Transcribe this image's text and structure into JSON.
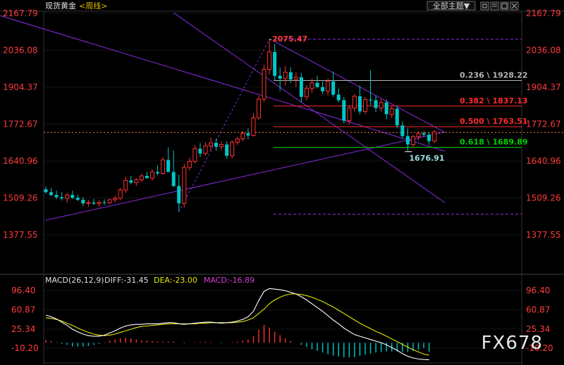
{
  "header": {
    "instrument": "现货黄金",
    "period": "<周线>",
    "menu_button": "全部主题▼",
    "window_controls": [
      "restore-icon",
      "window-icon",
      "window-expand-icon",
      "close-icon"
    ]
  },
  "colors": {
    "background": "#000000",
    "price_labels": "#ff3b3b",
    "up_candle": "#ff3232",
    "down_candle": "#00c8c8",
    "channel_lines": "#8a2be2",
    "fib_0236": "#b4b4b4",
    "fib_0382": "#ff2a2a",
    "fib_0500": "#ff2a2a",
    "fib_0618": "#00d000",
    "diff_line": "#ffffff",
    "dea_line": "#e6e600",
    "macd_label": "#d040d0"
  },
  "chart_data": [
    {
      "type": "candlestick",
      "title": "现货黄金<周线>",
      "ylim": [
        1377.55,
        2167.79
      ],
      "y_ticks": [
        "2167.79",
        "2036.08",
        "1904.37",
        "1772.67",
        "1640.96",
        "1509.26",
        "1377.55"
      ],
      "candles": [
        {
          "o": 1540,
          "h": 1550,
          "l": 1525,
          "c": 1530
        },
        {
          "o": 1530,
          "h": 1545,
          "l": 1515,
          "c": 1520
        },
        {
          "o": 1520,
          "h": 1535,
          "l": 1505,
          "c": 1512
        },
        {
          "o": 1512,
          "h": 1530,
          "l": 1500,
          "c": 1508
        },
        {
          "o": 1508,
          "h": 1528,
          "l": 1492,
          "c": 1520
        },
        {
          "o": 1520,
          "h": 1535,
          "l": 1505,
          "c": 1510
        },
        {
          "o": 1510,
          "h": 1522,
          "l": 1498,
          "c": 1503
        },
        {
          "o": 1503,
          "h": 1512,
          "l": 1480,
          "c": 1490
        },
        {
          "o": 1490,
          "h": 1502,
          "l": 1478,
          "c": 1493
        },
        {
          "o": 1493,
          "h": 1506,
          "l": 1484,
          "c": 1489
        },
        {
          "o": 1489,
          "h": 1500,
          "l": 1478,
          "c": 1494
        },
        {
          "o": 1494,
          "h": 1504,
          "l": 1484,
          "c": 1492
        },
        {
          "o": 1492,
          "h": 1506,
          "l": 1488,
          "c": 1503
        },
        {
          "o": 1503,
          "h": 1518,
          "l": 1493,
          "c": 1508
        },
        {
          "o": 1508,
          "h": 1545,
          "l": 1502,
          "c": 1538
        },
        {
          "o": 1538,
          "h": 1585,
          "l": 1528,
          "c": 1572
        },
        {
          "o": 1572,
          "h": 1588,
          "l": 1558,
          "c": 1564
        },
        {
          "o": 1564,
          "h": 1580,
          "l": 1552,
          "c": 1574
        },
        {
          "o": 1574,
          "h": 1595,
          "l": 1566,
          "c": 1588
        },
        {
          "o": 1588,
          "h": 1603,
          "l": 1578,
          "c": 1580
        },
        {
          "o": 1580,
          "h": 1612,
          "l": 1572,
          "c": 1602
        },
        {
          "o": 1602,
          "h": 1625,
          "l": 1590,
          "c": 1597
        },
        {
          "o": 1597,
          "h": 1655,
          "l": 1592,
          "c": 1645
        },
        {
          "o": 1645,
          "h": 1690,
          "l": 1610,
          "c": 1602
        },
        {
          "o": 1602,
          "h": 1678,
          "l": 1548,
          "c": 1552
        },
        {
          "o": 1552,
          "h": 1592,
          "l": 1460,
          "c": 1490
        },
        {
          "o": 1490,
          "h": 1632,
          "l": 1475,
          "c": 1618
        },
        {
          "o": 1618,
          "h": 1652,
          "l": 1608,
          "c": 1640
        },
        {
          "o": 1640,
          "h": 1698,
          "l": 1632,
          "c": 1685
        },
        {
          "o": 1685,
          "h": 1705,
          "l": 1655,
          "c": 1668
        },
        {
          "o": 1668,
          "h": 1708,
          "l": 1660,
          "c": 1695
        },
        {
          "o": 1695,
          "h": 1725,
          "l": 1675,
          "c": 1706
        },
        {
          "o": 1706,
          "h": 1722,
          "l": 1678,
          "c": 1692
        },
        {
          "o": 1692,
          "h": 1712,
          "l": 1680,
          "c": 1700
        },
        {
          "o": 1700,
          "h": 1712,
          "l": 1650,
          "c": 1660
        },
        {
          "o": 1660,
          "h": 1715,
          "l": 1650,
          "c": 1708
        },
        {
          "o": 1708,
          "h": 1728,
          "l": 1698,
          "c": 1720
        },
        {
          "o": 1720,
          "h": 1748,
          "l": 1712,
          "c": 1740
        },
        {
          "o": 1740,
          "h": 1758,
          "l": 1718,
          "c": 1732
        },
        {
          "o": 1732,
          "h": 1812,
          "l": 1728,
          "c": 1795
        },
        {
          "o": 1795,
          "h": 1875,
          "l": 1788,
          "c": 1862
        },
        {
          "o": 1862,
          "h": 1985,
          "l": 1852,
          "c": 1968
        },
        {
          "o": 1968,
          "h": 2075.47,
          "l": 1950,
          "c": 2030
        },
        {
          "o": 2030,
          "h": 2060,
          "l": 1930,
          "c": 1945
        },
        {
          "o": 1945,
          "h": 1975,
          "l": 1890,
          "c": 1935
        },
        {
          "o": 1935,
          "h": 1980,
          "l": 1910,
          "c": 1958
        },
        {
          "o": 1958,
          "h": 1975,
          "l": 1920,
          "c": 1932
        },
        {
          "o": 1932,
          "h": 1958,
          "l": 1905,
          "c": 1940
        },
        {
          "o": 1940,
          "h": 1955,
          "l": 1850,
          "c": 1870
        },
        {
          "o": 1870,
          "h": 1912,
          "l": 1858,
          "c": 1900
        },
        {
          "o": 1900,
          "h": 1935,
          "l": 1885,
          "c": 1920
        },
        {
          "o": 1920,
          "h": 1945,
          "l": 1900,
          "c": 1905
        },
        {
          "o": 1905,
          "h": 1925,
          "l": 1880,
          "c": 1890
        },
        {
          "o": 1890,
          "h": 1935,
          "l": 1875,
          "c": 1925
        },
        {
          "o": 1925,
          "h": 1960,
          "l": 1870,
          "c": 1878
        },
        {
          "o": 1878,
          "h": 1900,
          "l": 1850,
          "c": 1858
        },
        {
          "o": 1858,
          "h": 1870,
          "l": 1775,
          "c": 1785
        },
        {
          "o": 1785,
          "h": 1840,
          "l": 1772,
          "c": 1830
        },
        {
          "o": 1830,
          "h": 1880,
          "l": 1818,
          "c": 1872
        },
        {
          "o": 1872,
          "h": 1910,
          "l": 1808,
          "c": 1818
        },
        {
          "o": 1818,
          "h": 1870,
          "l": 1808,
          "c": 1860
        },
        {
          "o": 1860,
          "h": 1965,
          "l": 1840,
          "c": 1858
        },
        {
          "o": 1858,
          "h": 1875,
          "l": 1815,
          "c": 1830
        },
        {
          "o": 1830,
          "h": 1862,
          "l": 1818,
          "c": 1850
        },
        {
          "o": 1850,
          "h": 1860,
          "l": 1790,
          "c": 1808
        },
        {
          "o": 1808,
          "h": 1838,
          "l": 1795,
          "c": 1828
        },
        {
          "o": 1828,
          "h": 1838,
          "l": 1758,
          "c": 1768
        },
        {
          "o": 1768,
          "h": 1782,
          "l": 1722,
          "c": 1730
        },
        {
          "o": 1730,
          "h": 1758,
          "l": 1676.91,
          "c": 1700
        },
        {
          "o": 1700,
          "h": 1735,
          "l": 1690,
          "c": 1728
        },
        {
          "o": 1728,
          "h": 1748,
          "l": 1715,
          "c": 1740
        },
        {
          "o": 1740,
          "h": 1748,
          "l": 1728,
          "c": 1735
        },
        {
          "o": 1735,
          "h": 1742,
          "l": 1698,
          "c": 1712
        },
        {
          "o": 1712,
          "h": 1752,
          "l": 1705,
          "c": 1745
        }
      ],
      "annotations": {
        "high_label": "2075.47",
        "low_label": "1676.91",
        "high_value": 2075.47,
        "low_value": 1676.91
      },
      "fibonacci": [
        {
          "label": "0.236 \\ 1928.22",
          "value": 1928.22,
          "color": "#b4b4b4"
        },
        {
          "label": "0.382 \\ 1837.13",
          "value": 1837.13,
          "color": "#ff2a2a"
        },
        {
          "label": "0.500 \\ 1763.51",
          "value": 1763.51,
          "color": "#ff2a2a"
        },
        {
          "label": "0.618 \\ 1689.89",
          "value": 1689.89,
          "color": "#00d000"
        }
      ],
      "fib_bounds": [
        2075.47,
        1451.56
      ],
      "current_price_level": 1743,
      "trendlines": [
        {
          "x0": 0,
          "y0": 1430,
          "x1": 75,
          "y1": 1745
        },
        {
          "x0": -10,
          "y0": 2167.79,
          "x1": 75,
          "y1": 1676
        },
        {
          "x0": 24,
          "y0": 2170,
          "x1": 75,
          "y1": 1492
        },
        {
          "x0": 43,
          "y0": 2067,
          "x1": 75,
          "y1": 1743
        }
      ]
    },
    {
      "type": "macd",
      "title": "MACD(26,12,9)",
      "readouts": {
        "diff": "DIFF:-31.45",
        "dea": "DEA:-23.00",
        "macd": "MACD:-16.89"
      },
      "ylim": [
        -32,
        103
      ],
      "y_ticks": [
        "96.40",
        "60.87",
        "25.34",
        "-10.20"
      ],
      "diff": [
        51,
        48,
        44,
        38,
        32,
        25,
        20,
        16,
        13,
        12,
        12,
        14,
        18,
        22,
        27,
        31,
        33,
        34,
        34,
        35,
        35,
        35,
        36,
        37,
        37,
        35,
        34,
        35,
        36,
        37,
        38,
        38,
        37,
        36,
        37,
        38,
        40,
        43,
        48,
        58,
        78,
        95,
        100,
        99,
        98,
        96,
        93,
        90,
        85,
        79,
        72,
        65,
        58,
        50,
        42,
        35,
        27,
        21,
        15,
        12,
        9,
        6,
        3,
        0,
        -4,
        -9,
        -14,
        -20,
        -25,
        -28,
        -30,
        -31,
        -31.45
      ],
      "dea": [
        46,
        45,
        43,
        40,
        36,
        32,
        27,
        23,
        19,
        16,
        14,
        13,
        14,
        16,
        19,
        22,
        25,
        28,
        30,
        31,
        32,
        33,
        34,
        35,
        35,
        35,
        35,
        35,
        35,
        36,
        36,
        37,
        37,
        37,
        37,
        37,
        38,
        39,
        42,
        46,
        54,
        62,
        72,
        79,
        84,
        88,
        90,
        90,
        89,
        87,
        84,
        80,
        76,
        71,
        66,
        60,
        54,
        48,
        42,
        36,
        31,
        26,
        21,
        17,
        12,
        7,
        2,
        -3,
        -8,
        -13,
        -17,
        -21,
        -23
      ],
      "macd": [
        5,
        3,
        1,
        -2,
        -4,
        -7,
        -7,
        -7,
        -6,
        -4,
        -2,
        1,
        4,
        6,
        8,
        9,
        8,
        6,
        4,
        4,
        3,
        2,
        2,
        2,
        2,
        0,
        -1,
        0,
        1,
        1,
        2,
        1,
        0,
        -1,
        0,
        1,
        2,
        4,
        6,
        12,
        24,
        33,
        28,
        20,
        14,
        8,
        3,
        0,
        -4,
        -8,
        -12,
        -15,
        -18,
        -21,
        -24,
        -25,
        -27,
        -27,
        -27,
        -24,
        -22,
        -20,
        -18,
        -17,
        -16,
        -16,
        -16,
        -17,
        -17,
        -15,
        -13,
        -10,
        -16.89
      ]
    }
  ],
  "watermark": "FX678"
}
